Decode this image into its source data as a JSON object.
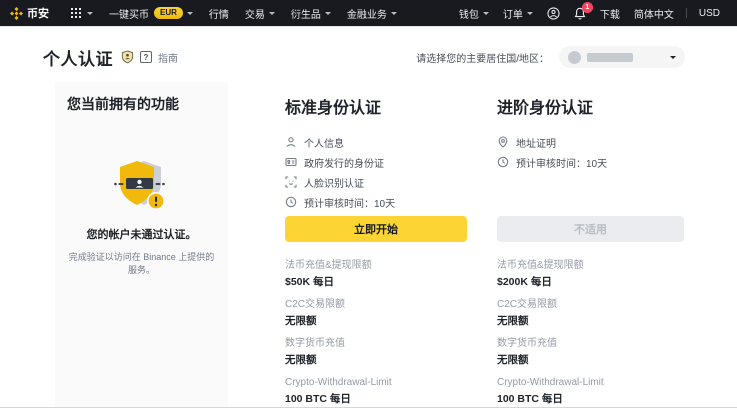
{
  "colors": {
    "brand_yellow": "#F0B90B",
    "button_yellow": "#FCD535",
    "notification_red": "#F6465D"
  },
  "navbar": {
    "brand": "币安",
    "items": [
      {
        "label": "一键买币",
        "badge": "EUR"
      },
      {
        "label": "行情"
      },
      {
        "label": "交易"
      },
      {
        "label": "衍生品"
      },
      {
        "label": "金融业务"
      }
    ],
    "right": {
      "wallet": "钱包",
      "orders": "订单",
      "notification_count": "1",
      "download": "下载",
      "language": "简体中文",
      "currency": "USD"
    }
  },
  "header": {
    "title": "个人认证",
    "guide": "指南",
    "country_label": "请选择您的主要居住国/地区："
  },
  "current_panel": {
    "heading": "您当前拥有的功能",
    "status": "您的帐户未通过认证。",
    "description": "完成验证以访问在 Binance 上提供的服务。"
  },
  "standard": {
    "title": "标准身份认证",
    "features": [
      {
        "icon": "person-icon",
        "label": "个人信息"
      },
      {
        "icon": "id-card-icon",
        "label": "政府发行的身份证"
      },
      {
        "icon": "face-id-icon",
        "label": "人脸识别认证"
      },
      {
        "icon": "clock-icon",
        "label": "预计审核时间：10天"
      }
    ],
    "button": "立即开始",
    "stats": [
      {
        "label": "法币充值&提现限额",
        "value": "$50K 每日"
      },
      {
        "label": "C2C交易限额",
        "value": "无限额"
      },
      {
        "label": "数字货币充值",
        "value": "无限额"
      },
      {
        "label": "Crypto-Withdrawal-Limit",
        "value": "100 BTC 每日"
      }
    ]
  },
  "advanced": {
    "title": "进阶身份认证",
    "features": [
      {
        "icon": "location-pin-icon",
        "label": "地址证明"
      },
      {
        "icon": "clock-icon",
        "label": "预计审核时间：10天"
      }
    ],
    "button": "不适用",
    "stats": [
      {
        "label": "法币充值&提现限额",
        "value": "$200K 每日"
      },
      {
        "label": "C2C交易限额",
        "value": "无限额"
      },
      {
        "label": "数字货币充值",
        "value": "无限额"
      },
      {
        "label": "Crypto-Withdrawal-Limit",
        "value": "100 BTC 每日"
      }
    ]
  }
}
